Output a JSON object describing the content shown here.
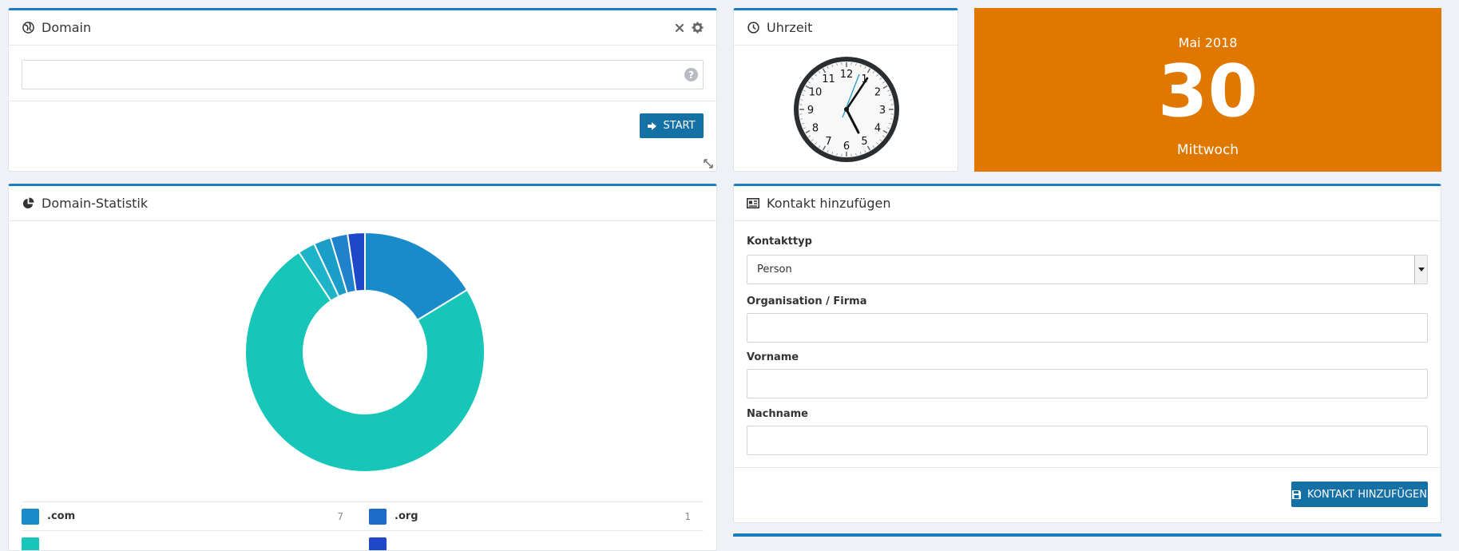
{
  "domain_panel": {
    "title": "Domain",
    "input_value": "",
    "input_placeholder": "",
    "help_glyph": "?",
    "start_label": "START"
  },
  "clock_panel": {
    "title": "Uhrzeit",
    "numbers": [
      "12",
      "1",
      "2",
      "3",
      "4",
      "5",
      "6",
      "7",
      "8",
      "9",
      "10",
      "11"
    ]
  },
  "date_tile": {
    "month_year": "Mai 2018",
    "day": "30",
    "weekday": "Mittwoch",
    "background": "#e07800"
  },
  "stats_panel": {
    "title": "Domain-Statistik",
    "legend": [
      {
        "label": ".com",
        "value": "7",
        "color": "#1a8bc9"
      },
      {
        "label": ".org",
        "value": "1",
        "color": "#1e6cc9"
      }
    ]
  },
  "chart_data": {
    "type": "pie",
    "categories": [
      ".com",
      "",
      "",
      "",
      "",
      ".org"
    ],
    "values": [
      7,
      32,
      1,
      1,
      1,
      1
    ],
    "colors": [
      "#1a8bc9",
      "#17c6b8",
      "#1eb3c8",
      "#1a9dc6",
      "#1f82cb",
      "#1e48c9"
    ]
  },
  "contact_panel": {
    "title": "Kontakt hinzufügen",
    "kontakttyp_label": "Kontakttyp",
    "kontakttyp_value": "Person",
    "organisation_label": "Organisation / Firma",
    "vorname_label": "Vorname",
    "nachname_label": "Nachname",
    "submit_label": "KONTAKT HINZUFÜGEN"
  },
  "colors": {
    "accent": "#1a7dc1",
    "button": "#1570a6"
  }
}
